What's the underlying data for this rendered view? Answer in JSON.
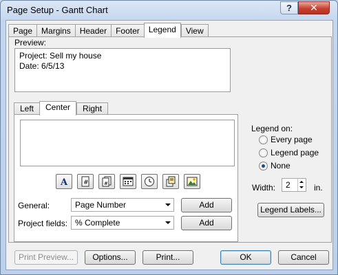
{
  "window": {
    "title": "Page Setup - Gantt Chart",
    "help_label": "?",
    "close_label": "✕"
  },
  "tabs": [
    "Page",
    "Margins",
    "Header",
    "Footer",
    "Legend",
    "View"
  ],
  "active_tab": "Legend",
  "preview": {
    "label": "Preview:",
    "lines": [
      "Project: Sell my house",
      "Date: 6/5/13"
    ]
  },
  "alignment_tabs": [
    "Left",
    "Center",
    "Right"
  ],
  "active_alignment_tab": "Center",
  "toolbar_icons": [
    "format-text-font-icon",
    "insert-page-number-icon",
    "insert-total-pages-icon",
    "insert-current-date-icon",
    "insert-current-time-icon",
    "insert-file-name-icon",
    "insert-picture-icon"
  ],
  "general": {
    "label": "General:",
    "selected": "Page Number",
    "add_label": "Add"
  },
  "project_fields": {
    "label": "Project fields:",
    "selected": "% Complete",
    "add_label": "Add"
  },
  "legend_on": {
    "label": "Legend on:",
    "options": [
      "Every page",
      "Legend page",
      "None"
    ],
    "selected": "None"
  },
  "width": {
    "label": "Width:",
    "value": "2",
    "unit": "in."
  },
  "legend_labels_button": "Legend Labels...",
  "footer_buttons": {
    "print_preview": "Print Preview...",
    "options": "Options...",
    "print": "Print...",
    "ok": "OK",
    "cancel": "Cancel"
  }
}
